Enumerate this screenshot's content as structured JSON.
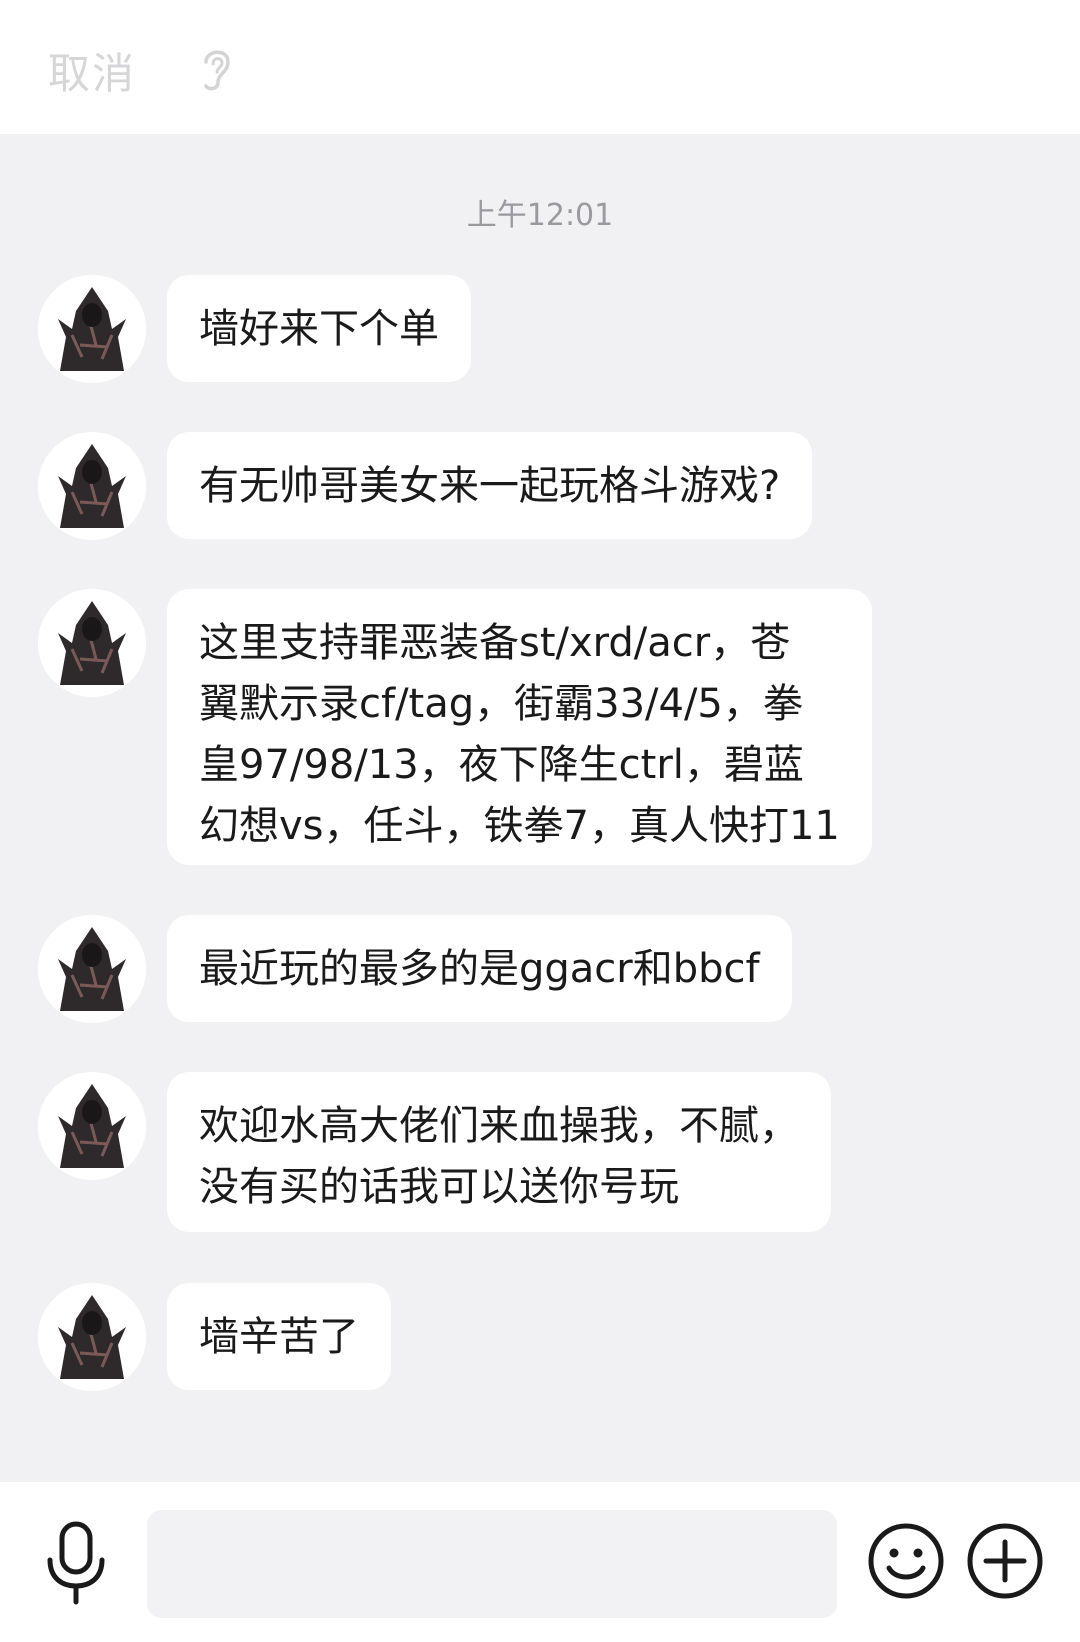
{
  "header": {
    "cancel_label": "取消",
    "voice_icon": "ear-icon"
  },
  "conversation": {
    "timestamp": "上午12:01",
    "messages": [
      {
        "text": "墙好来下个单"
      },
      {
        "text": "有无帅哥美女来一起玩格斗游戏?"
      },
      {
        "text": "这里支持罪恶装备st/xrd/acr，苍\n翼默示录cf/tag，街霸33/4/5，拳\n皇97/98/13，夜下降生ctrl，碧蓝\n幻想vs，任斗，铁拳7，真人快打11"
      },
      {
        "text": "最近玩的最多的是ggacr和bbcf"
      },
      {
        "text": "欢迎水高大佬们来血操我，不腻，\n没有买的话我可以送你号玩"
      },
      {
        "text": "墙辛苦了"
      }
    ]
  },
  "input_bar": {
    "mic_icon": "microphone-icon",
    "emoji_icon": "emoji-icon",
    "plus_icon": "plus-icon",
    "message_value": ""
  },
  "colors": {
    "background": "#f1f1f3",
    "bubble": "#ffffff",
    "muted_text": "#9a9a9e"
  }
}
